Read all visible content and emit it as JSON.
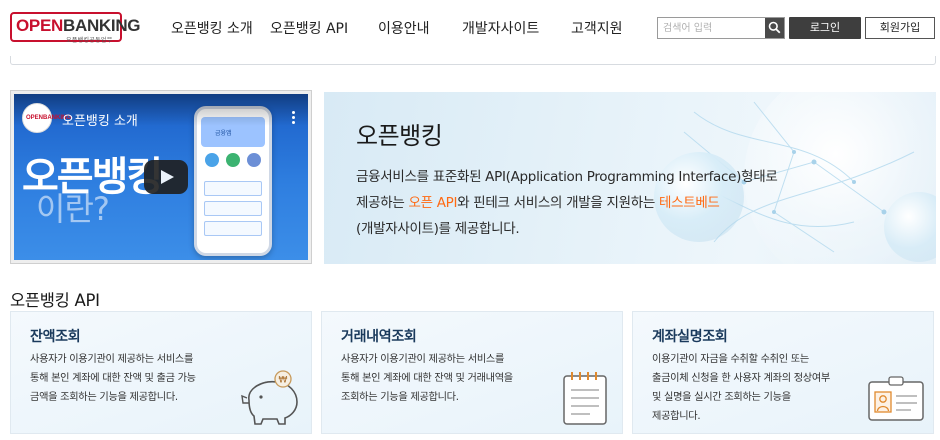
{
  "header": {
    "logo_text_open": "OPEN",
    "logo_text_banking": "BANKING",
    "logo_subtext": "오픈뱅킹공동업무",
    "nav": [
      {
        "label": "오픈뱅킹 소개"
      },
      {
        "label": "오픈뱅킹 API"
      },
      {
        "label": "이용안내"
      },
      {
        "label": "개발자사이트"
      },
      {
        "label": "고객지원"
      }
    ],
    "search_placeholder": "검색어 입력",
    "login_label": "로그인",
    "join_label": "회원가입"
  },
  "video": {
    "channel_logo": "OPENBANKING",
    "title": "오픈뱅킹 소개",
    "overlay_line1": "오픈뱅킹",
    "overlay_line2": "이란?",
    "phone_header": "금융앱"
  },
  "intro": {
    "title": "오픈뱅킹",
    "line1": "금융서비스를 표준화된 API(Application Programming Interface)형태로",
    "line2_pre": "제공하는 ",
    "line2_hl1": "오픈 API",
    "line2_mid": "와 핀테크 서비스의 개발을 지원하는 ",
    "line2_hl2": "테스트베드",
    "line3": "(개발자사이트)를 제공합니다."
  },
  "api_section": {
    "title": "오픈뱅킹 API",
    "cards": [
      {
        "title": "잔액조회",
        "desc": [
          "사용자가 이용기관이 제공하는 서비스를",
          "통해 본인 계좌에 대한 잔액 및 출금 가능",
          "금액을 조회하는 기능을 제공합니다."
        ],
        "icon": "piggy-bank-icon"
      },
      {
        "title": "거래내역조회",
        "desc": [
          "사용자가 이용기관이 제공하는 서비스를",
          "통해 본인 계좌에 대한 잔액 및 거래내역을",
          "조회하는 기능을 제공합니다."
        ],
        "icon": "notepad-icon"
      },
      {
        "title": "계좌실명조회",
        "desc": [
          "이용기관이 자금을 수취할 수취인 또는",
          "출금이체 신청을 한 사용자 계좌의 정상여부",
          "및 실명을 실시간 조회하는 기능을",
          "제공합니다."
        ],
        "icon": "id-card-icon"
      }
    ]
  },
  "colors": {
    "brand_red": "#c8102e",
    "highlight_orange": "#ff6a13",
    "login_bg": "#3e3e3e"
  }
}
